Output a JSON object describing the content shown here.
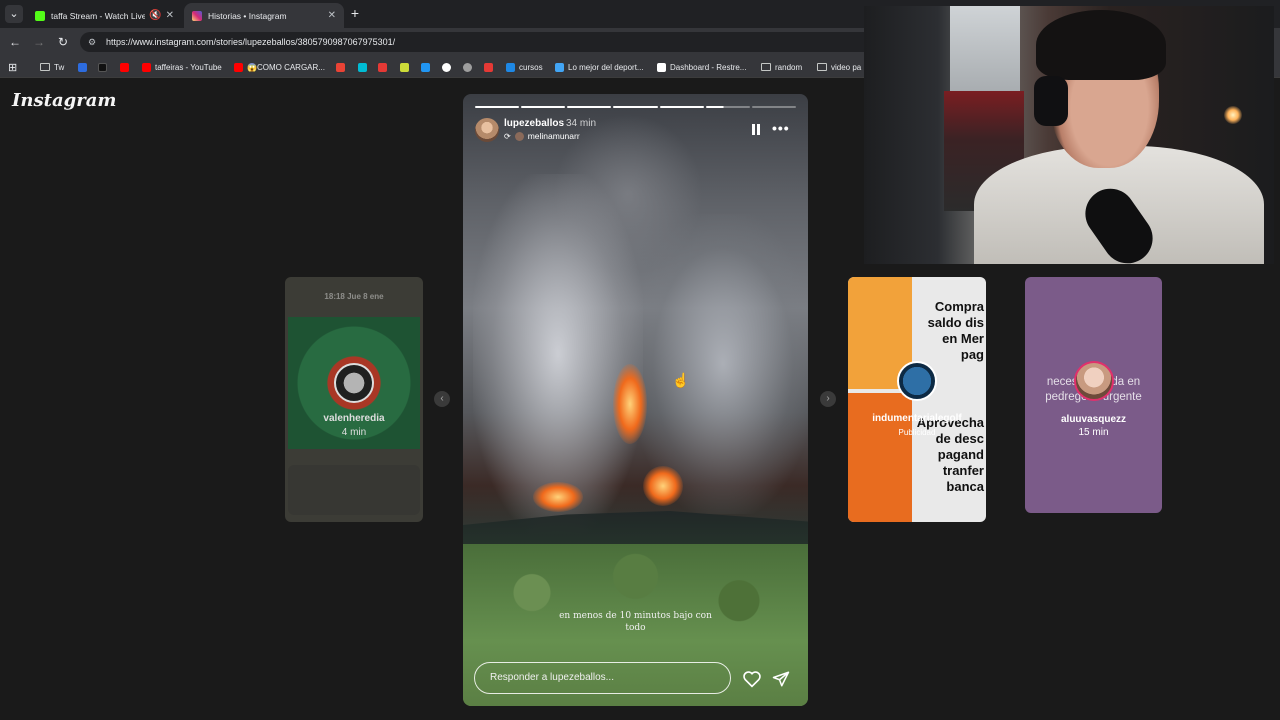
{
  "browser": {
    "tabs": [
      {
        "title": "taffa Stream - Watch Live o",
        "active": false,
        "favicon_color": "#53fc18"
      },
      {
        "title": "Historias • Instagram",
        "active": true,
        "favicon_color": "#e1306c"
      }
    ],
    "url": "https://www.instagram.com/stories/lupezeballos/3805790987067975301/",
    "bookmarks": [
      {
        "label": "Tw",
        "icon": "folder-icon"
      },
      {
        "label": "",
        "icon": "paypal-icon",
        "color": "#2d6cdf"
      },
      {
        "label": "",
        "icon": "tiktok-icon",
        "color": "#000000"
      },
      {
        "label": "",
        "icon": "youtube-icon",
        "color": "#ff0000"
      },
      {
        "label": "taffeiras - YouTube",
        "icon": "youtube-icon",
        "color": "#ff0000"
      },
      {
        "label": "😱COMO CARGAR...",
        "icon": "youtube-icon",
        "color": "#ff0000"
      },
      {
        "label": "",
        "icon": "gmail-icon",
        "color": "#ea4335"
      },
      {
        "label": "",
        "icon": "p-icon",
        "color": "#00bcd4"
      },
      {
        "label": "",
        "icon": "bookmark-icon",
        "color": "#e53935"
      },
      {
        "label": "",
        "icon": "bookmark-icon",
        "color": "#4caf50"
      },
      {
        "label": "",
        "icon": "bookmark-icon",
        "color": "#cddc39"
      },
      {
        "label": "",
        "icon": "bookmark-icon",
        "color": "#2196f3"
      },
      {
        "label": "",
        "icon": "bookmark-icon",
        "color": "#ffffff"
      },
      {
        "label": "",
        "icon": "bookmark-icon",
        "color": "#9e9e9e"
      },
      {
        "label": "",
        "icon": "river-icon",
        "color": "#e53935"
      },
      {
        "label": "cursos",
        "icon": "bookmark-icon",
        "color": "#1e88e5"
      },
      {
        "label": "Lo mejor del deport...",
        "icon": "bookmark-icon",
        "color": "#42a5f5"
      },
      {
        "label": "Dashboard - Restre...",
        "icon": "r-icon",
        "color": "#ffffff"
      },
      {
        "label": "random",
        "icon": "folder-icon"
      },
      {
        "label": "video pa",
        "icon": "folder-icon"
      }
    ]
  },
  "instagram": {
    "logo": "Instagram",
    "story": {
      "username": "lupezeballos",
      "time": "34 min",
      "reshared_from": "melinamunarr",
      "progress_segments": 7,
      "progress_done": 5,
      "caption": "en menos de 10 minutos bajo con todo",
      "reply_placeholder": "Responder a lupezeballos..."
    },
    "side_stories": [
      {
        "username": "valenheredia",
        "time": "4 min",
        "header": "18:18   Jue 8 ene"
      },
      {
        "username": "indumentarialegolf",
        "time": "Publicidad",
        "ad_text": [
          "Compra",
          "saldo dis",
          "en Mer",
          "pag",
          "Aprovecha",
          "de desc",
          "pagand",
          "tranfer",
          "banca"
        ]
      },
      {
        "username": "aluuvasquezz",
        "time": "15 min",
        "text": "necesito ayuda en pedregoso urgente"
      }
    ]
  }
}
